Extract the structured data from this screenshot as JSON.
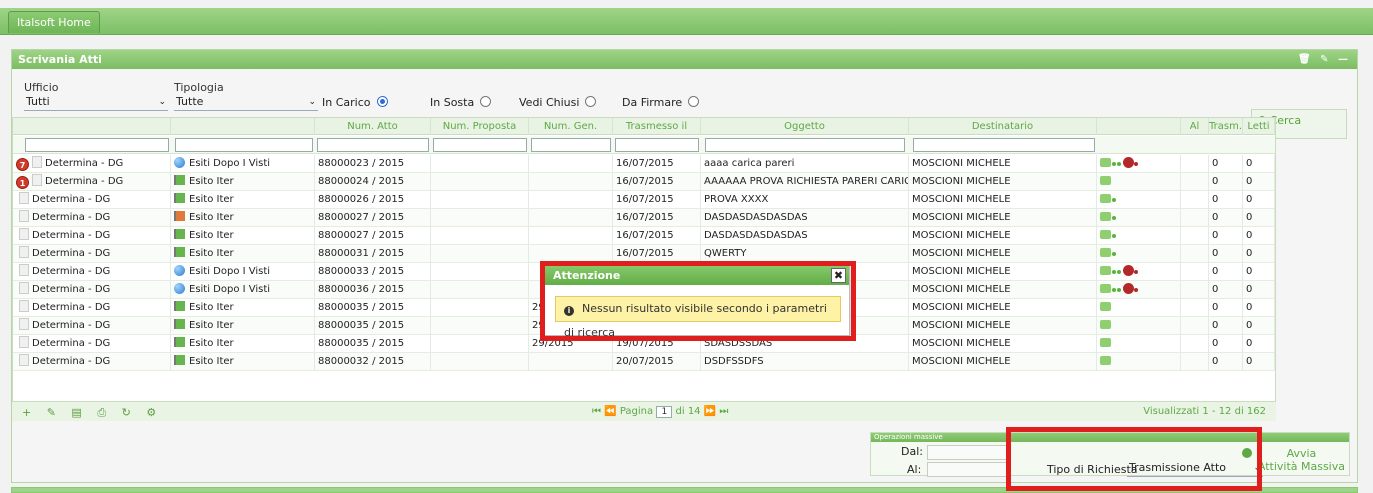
{
  "topbar": {
    "tab_label": "Italsoft Home"
  },
  "panel": {
    "title": "Scrivania Atti",
    "tools": "🗑 ✎ —"
  },
  "filters": {
    "ufficio_label": "Ufficio",
    "ufficio_value": "Tutti",
    "tipologia_label": "Tipologia",
    "tipologia_value": "Tutte",
    "radios": [
      "In Carico",
      "In Sosta",
      "Vedi Chiusi",
      "Da Firmare"
    ],
    "selected_radio": "In Carico",
    "cerca_label": "Cerca"
  },
  "grid": {
    "headers": [
      "Num. Atto",
      "Num. Proposta",
      "Num. Gen.",
      "Trasmesso il",
      "Oggetto",
      "Destinatario",
      "Al Termine",
      "Trasm.",
      "Letti"
    ],
    "rows": [
      {
        "badge": "7",
        "tipo": "Determina - DG",
        "esito": "Esiti Dopo I Visti",
        "esito_icon": "globe",
        "num_atto": "88000023 / 2015",
        "num_gen": "",
        "trasmesso": "16/07/2015",
        "oggetto": "aaaa carica pareri",
        "destinatario": "MOSCIONI MICHELE",
        "status": "full",
        "trasm": "0",
        "letti": "0"
      },
      {
        "badge": "1",
        "tipo": "Determina - DG",
        "esito": "Esito Iter",
        "esito_icon": "flag-green",
        "num_atto": "88000024 / 2015",
        "num_gen": "",
        "trasmesso": "16/07/2015",
        "oggetto": "AAAAAA PROVA RICHIESTA PARERI CARICA PARERI",
        "destinatario": "MOSCIONI MICHELE",
        "status": "plain",
        "trasm": "0",
        "letti": "0"
      },
      {
        "badge": "",
        "tipo": "Determina - DG",
        "esito": "Esito Iter",
        "esito_icon": "flag-green",
        "num_atto": "88000026 / 2015",
        "num_gen": "",
        "trasmesso": "16/07/2015",
        "oggetto": "PROVA XXXX",
        "destinatario": "MOSCIONI MICHELE",
        "status": "dot",
        "trasm": "0",
        "letti": "0"
      },
      {
        "badge": "",
        "tipo": "Determina - DG",
        "esito": "Esito Iter",
        "esito_icon": "flag-orange",
        "num_atto": "88000027 / 2015",
        "num_gen": "",
        "trasmesso": "16/07/2015",
        "oggetto": "DASDASDASDASDAS",
        "destinatario": "MOSCIONI MICHELE",
        "status": "dot",
        "trasm": "0",
        "letti": "0"
      },
      {
        "badge": "",
        "tipo": "Determina - DG",
        "esito": "Esito Iter",
        "esito_icon": "flag-green",
        "num_atto": "88000027 / 2015",
        "num_gen": "",
        "trasmesso": "16/07/2015",
        "oggetto": "DASDASDASDASDAS",
        "destinatario": "MOSCIONI MICHELE",
        "status": "dot",
        "trasm": "0",
        "letti": "0"
      },
      {
        "badge": "",
        "tipo": "Determina - DG",
        "esito": "Esito Iter",
        "esito_icon": "flag-green",
        "num_atto": "88000031 / 2015",
        "num_gen": "",
        "trasmesso": "16/07/2015",
        "oggetto": "QWERTY",
        "destinatario": "MOSCIONI MICHELE",
        "status": "dot",
        "trasm": "0",
        "letti": "0"
      },
      {
        "badge": "",
        "tipo": "Determina - DG",
        "esito": "Esiti Dopo I Visti",
        "esito_icon": "globe",
        "num_atto": "88000033 / 2015",
        "num_gen": "",
        "trasmesso": "",
        "oggetto": "",
        "destinatario": "MOSCIONI MICHELE",
        "status": "full",
        "trasm": "0",
        "letti": "0"
      },
      {
        "badge": "",
        "tipo": "Determina - DG",
        "esito": "Esiti Dopo I Visti",
        "esito_icon": "globe",
        "num_atto": "88000036 / 2015",
        "num_gen": "",
        "trasmesso": "",
        "oggetto": "",
        "destinatario": "MOSCIONI MICHELE",
        "status": "full",
        "trasm": "0",
        "letti": "0"
      },
      {
        "badge": "",
        "tipo": "Determina - DG",
        "esito": "Esito Iter",
        "esito_icon": "flag-green",
        "num_atto": "88000035 / 2015",
        "num_gen": "29",
        "trasmesso": "",
        "oggetto": "",
        "destinatario": "MOSCIONI MICHELE",
        "status": "plain",
        "trasm": "0",
        "letti": "0"
      },
      {
        "badge": "",
        "tipo": "Determina - DG",
        "esito": "Esito Iter",
        "esito_icon": "flag-green",
        "num_atto": "88000035 / 2015",
        "num_gen": "29",
        "trasmesso": "",
        "oggetto": "",
        "destinatario": "MOSCIONI MICHELE",
        "status": "flag",
        "trasm": "0",
        "letti": "0"
      },
      {
        "badge": "",
        "tipo": "Determina - DG",
        "esito": "Esito Iter",
        "esito_icon": "flag-green",
        "num_atto": "88000035 / 2015",
        "num_gen": "29/2015",
        "trasmesso": "19/07/2015",
        "oggetto": "SDASDSSDAS",
        "destinatario": "MOSCIONI MICHELE",
        "status": "plain",
        "trasm": "0",
        "letti": "0"
      },
      {
        "badge": "",
        "tipo": "Determina - DG",
        "esito": "Esito Iter",
        "esito_icon": "flag-green",
        "num_atto": "88000032 / 2015",
        "num_gen": "",
        "trasmesso": "20/07/2015",
        "oggetto": "DSDFSSDFS",
        "destinatario": "MOSCIONI MICHELE",
        "status": "flag",
        "trasm": "0",
        "letti": "0"
      }
    ]
  },
  "pager": {
    "page_label": "Pagina",
    "page_value": "1",
    "of_label": "di 14",
    "info": "Visualizzati 1 - 12 di 162"
  },
  "massive": {
    "title": "Operazioni massive",
    "dal_label": "Dal:",
    "al_label": "Al:",
    "tipo_label": "Tipo di Richiesta",
    "tipo_value": "Trasmissione Atto",
    "avvia_line1": "Avvia",
    "avvia_line2": "Attività Massiva"
  },
  "modal": {
    "title": "Attenzione",
    "close": "✖",
    "message": "Nessun risultato visibile secondo i parametri di ricerca",
    "info_icon": "i"
  },
  "colors": {
    "accent": "#7cc065",
    "alert_bg": "#fdf2a6",
    "highlight": "#e01e1e"
  }
}
